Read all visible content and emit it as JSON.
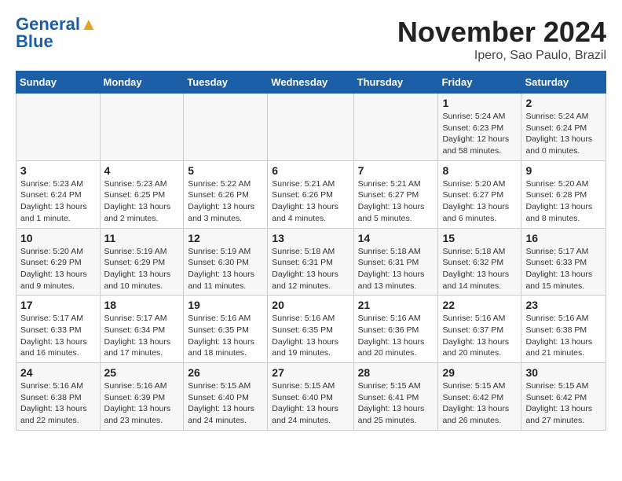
{
  "header": {
    "logo_line1": "General",
    "logo_line2": "Blue",
    "month": "November 2024",
    "location": "Ipero, Sao Paulo, Brazil"
  },
  "days_of_week": [
    "Sunday",
    "Monday",
    "Tuesday",
    "Wednesday",
    "Thursday",
    "Friday",
    "Saturday"
  ],
  "weeks": [
    [
      {
        "day": "",
        "info": ""
      },
      {
        "day": "",
        "info": ""
      },
      {
        "day": "",
        "info": ""
      },
      {
        "day": "",
        "info": ""
      },
      {
        "day": "",
        "info": ""
      },
      {
        "day": "1",
        "info": "Sunrise: 5:24 AM\nSunset: 6:23 PM\nDaylight: 12 hours and 58 minutes."
      },
      {
        "day": "2",
        "info": "Sunrise: 5:24 AM\nSunset: 6:24 PM\nDaylight: 13 hours and 0 minutes."
      }
    ],
    [
      {
        "day": "3",
        "info": "Sunrise: 5:23 AM\nSunset: 6:24 PM\nDaylight: 13 hours and 1 minute."
      },
      {
        "day": "4",
        "info": "Sunrise: 5:23 AM\nSunset: 6:25 PM\nDaylight: 13 hours and 2 minutes."
      },
      {
        "day": "5",
        "info": "Sunrise: 5:22 AM\nSunset: 6:26 PM\nDaylight: 13 hours and 3 minutes."
      },
      {
        "day": "6",
        "info": "Sunrise: 5:21 AM\nSunset: 6:26 PM\nDaylight: 13 hours and 4 minutes."
      },
      {
        "day": "7",
        "info": "Sunrise: 5:21 AM\nSunset: 6:27 PM\nDaylight: 13 hours and 5 minutes."
      },
      {
        "day": "8",
        "info": "Sunrise: 5:20 AM\nSunset: 6:27 PM\nDaylight: 13 hours and 6 minutes."
      },
      {
        "day": "9",
        "info": "Sunrise: 5:20 AM\nSunset: 6:28 PM\nDaylight: 13 hours and 8 minutes."
      }
    ],
    [
      {
        "day": "10",
        "info": "Sunrise: 5:20 AM\nSunset: 6:29 PM\nDaylight: 13 hours and 9 minutes."
      },
      {
        "day": "11",
        "info": "Sunrise: 5:19 AM\nSunset: 6:29 PM\nDaylight: 13 hours and 10 minutes."
      },
      {
        "day": "12",
        "info": "Sunrise: 5:19 AM\nSunset: 6:30 PM\nDaylight: 13 hours and 11 minutes."
      },
      {
        "day": "13",
        "info": "Sunrise: 5:18 AM\nSunset: 6:31 PM\nDaylight: 13 hours and 12 minutes."
      },
      {
        "day": "14",
        "info": "Sunrise: 5:18 AM\nSunset: 6:31 PM\nDaylight: 13 hours and 13 minutes."
      },
      {
        "day": "15",
        "info": "Sunrise: 5:18 AM\nSunset: 6:32 PM\nDaylight: 13 hours and 14 minutes."
      },
      {
        "day": "16",
        "info": "Sunrise: 5:17 AM\nSunset: 6:33 PM\nDaylight: 13 hours and 15 minutes."
      }
    ],
    [
      {
        "day": "17",
        "info": "Sunrise: 5:17 AM\nSunset: 6:33 PM\nDaylight: 13 hours and 16 minutes."
      },
      {
        "day": "18",
        "info": "Sunrise: 5:17 AM\nSunset: 6:34 PM\nDaylight: 13 hours and 17 minutes."
      },
      {
        "day": "19",
        "info": "Sunrise: 5:16 AM\nSunset: 6:35 PM\nDaylight: 13 hours and 18 minutes."
      },
      {
        "day": "20",
        "info": "Sunrise: 5:16 AM\nSunset: 6:35 PM\nDaylight: 13 hours and 19 minutes."
      },
      {
        "day": "21",
        "info": "Sunrise: 5:16 AM\nSunset: 6:36 PM\nDaylight: 13 hours and 20 minutes."
      },
      {
        "day": "22",
        "info": "Sunrise: 5:16 AM\nSunset: 6:37 PM\nDaylight: 13 hours and 20 minutes."
      },
      {
        "day": "23",
        "info": "Sunrise: 5:16 AM\nSunset: 6:38 PM\nDaylight: 13 hours and 21 minutes."
      }
    ],
    [
      {
        "day": "24",
        "info": "Sunrise: 5:16 AM\nSunset: 6:38 PM\nDaylight: 13 hours and 22 minutes."
      },
      {
        "day": "25",
        "info": "Sunrise: 5:16 AM\nSunset: 6:39 PM\nDaylight: 13 hours and 23 minutes."
      },
      {
        "day": "26",
        "info": "Sunrise: 5:15 AM\nSunset: 6:40 PM\nDaylight: 13 hours and 24 minutes."
      },
      {
        "day": "27",
        "info": "Sunrise: 5:15 AM\nSunset: 6:40 PM\nDaylight: 13 hours and 24 minutes."
      },
      {
        "day": "28",
        "info": "Sunrise: 5:15 AM\nSunset: 6:41 PM\nDaylight: 13 hours and 25 minutes."
      },
      {
        "day": "29",
        "info": "Sunrise: 5:15 AM\nSunset: 6:42 PM\nDaylight: 13 hours and 26 minutes."
      },
      {
        "day": "30",
        "info": "Sunrise: 5:15 AM\nSunset: 6:42 PM\nDaylight: 13 hours and 27 minutes."
      }
    ]
  ]
}
